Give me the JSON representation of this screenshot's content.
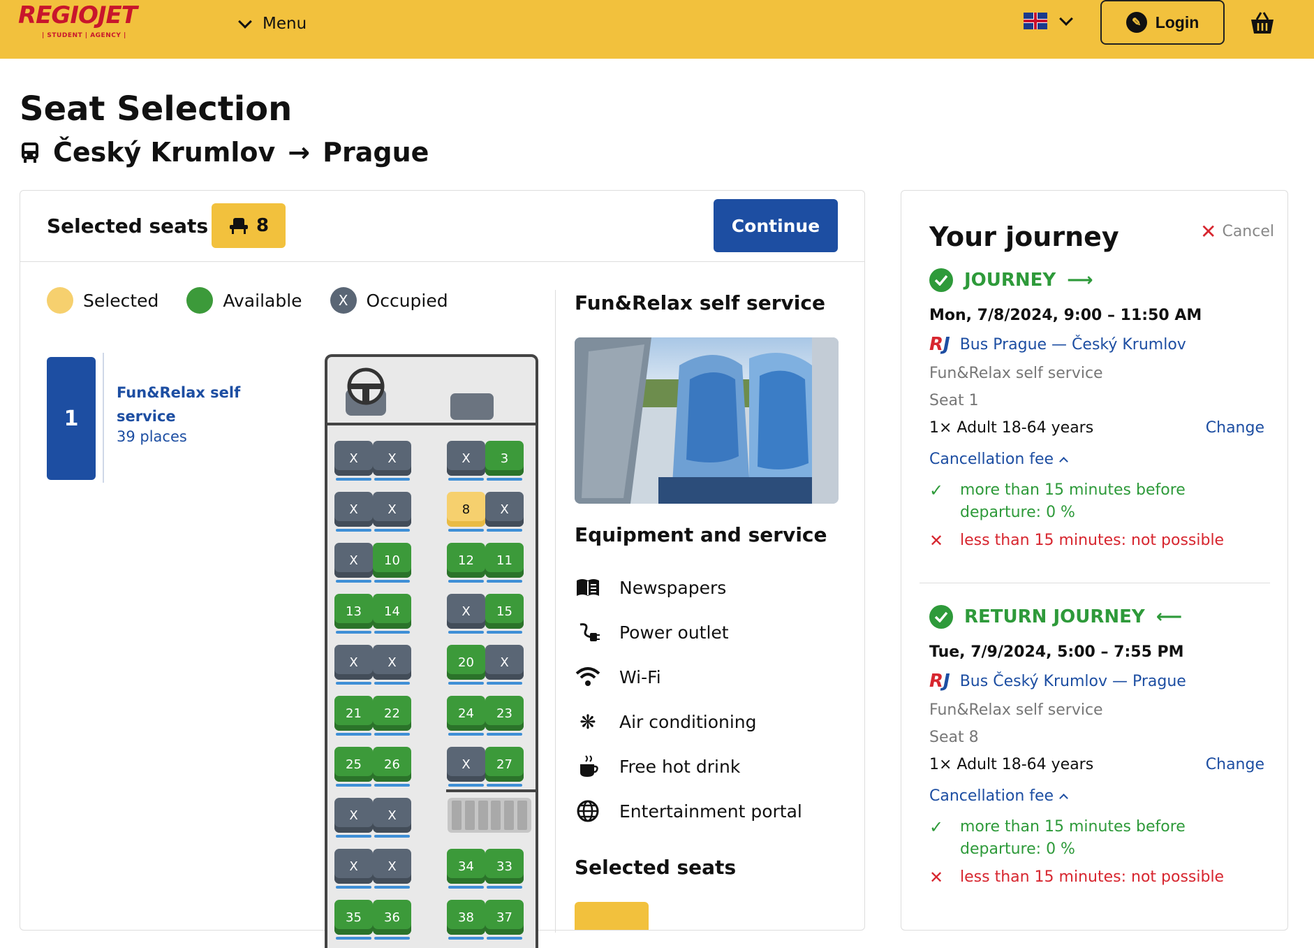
{
  "header": {
    "logo_text": "REGIOJET",
    "logo_sub": "| STUDENT | AGENCY |",
    "menu_label": "Menu",
    "login_label": "Login"
  },
  "page": {
    "title": "Seat Selection",
    "route_from": "Český Krumlov",
    "route_arrow": "→",
    "route_to": "Prague"
  },
  "selection": {
    "label": "Selected seats",
    "count": "8",
    "continue_label": "Continue"
  },
  "legend": {
    "selected": "Selected",
    "available": "Available",
    "occupied": "Occupied",
    "occupied_mark": "X"
  },
  "car": {
    "number": "1",
    "name": "Fun&Relax self service",
    "places": "39 places"
  },
  "seatmap": {
    "rows": [
      [
        "X",
        "X",
        "X",
        "3"
      ],
      [
        "X",
        "X",
        "8",
        "X"
      ],
      [
        "X",
        "10",
        "12",
        "11"
      ],
      [
        "13",
        "14",
        "X",
        "15"
      ],
      [
        "X",
        "X",
        "20",
        "X"
      ],
      [
        "21",
        "22",
        "24",
        "23"
      ],
      [
        "25",
        "26",
        "X",
        "27"
      ],
      [
        "X",
        "X",
        "",
        ""
      ],
      [
        "X",
        "X",
        "34",
        "33"
      ],
      [
        "35",
        "36",
        "38",
        "37"
      ]
    ],
    "selected": [
      "8"
    ]
  },
  "service": {
    "title": "Fun&Relax self service",
    "equipment_title": "Equipment and service",
    "items": [
      {
        "label": "Newspapers",
        "icon": "newspaper-icon"
      },
      {
        "label": "Power outlet",
        "icon": "power-outlet-icon"
      },
      {
        "label": "Wi-Fi",
        "icon": "wifi-icon"
      },
      {
        "label": "Air conditioning",
        "icon": "snowflake-icon"
      },
      {
        "label": "Free hot drink",
        "icon": "hot-drink-icon"
      },
      {
        "label": "Entertainment portal",
        "icon": "globe-icon"
      }
    ],
    "selected_seats_title": "Selected seats"
  },
  "journey": {
    "title": "Your journey",
    "cancel_label": "Cancel",
    "outbound": {
      "heading": "JOURNEY",
      "arrow": "⟶",
      "date": "Mon, 7/8/2024, 9:00 – 11:50 AM",
      "line": "Bus Prague — Český Krumlov",
      "service": "Fun&Relax self service",
      "seat": "Seat 1",
      "passenger": "1× Adult 18-64 years",
      "change_label": "Change",
      "cancellation_label": "Cancellation fee",
      "fee_ok": "more than 15 minutes before departure: 0 %",
      "fee_no": "less than 15 minutes: not possible"
    },
    "return": {
      "heading": "RETURN JOURNEY",
      "arrow": "⟵",
      "date": "Tue, 7/9/2024, 5:00 – 7:55 PM",
      "line": "Bus Český Krumlov — Prague",
      "service": "Fun&Relax self service",
      "seat": "Seat 8",
      "passenger": "1× Adult 18-64 years",
      "change_label": "Change",
      "cancellation_label": "Cancellation fee",
      "fee_ok": "more than 15 minutes before departure: 0 %",
      "fee_no": "less than 15 minutes: not possible"
    }
  },
  "colors": {
    "brand_yellow": "#f2c13d",
    "brand_blue": "#1d4ea2",
    "available_green": "#3c9a3a",
    "occupied_gray": "#5a6675",
    "error_red": "#d7262f"
  }
}
